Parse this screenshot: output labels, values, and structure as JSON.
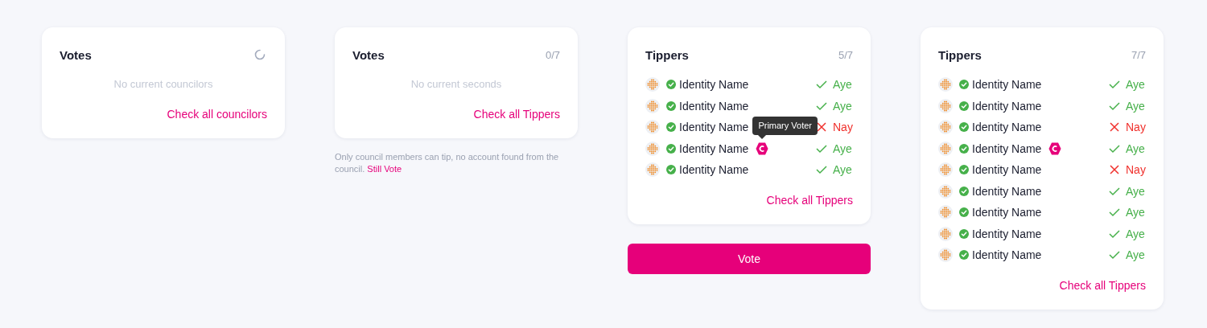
{
  "panels": [
    {
      "title": "Votes",
      "loading": true,
      "empty_text": "No current councilors",
      "link": "Check all councilors"
    },
    {
      "title": "Votes",
      "count": "0/7",
      "empty_text": "No current seconds",
      "link": "Check all Tippers",
      "note": {
        "text": "Only council members can tip, no account found from the council.",
        "link": "Still Vote"
      }
    },
    {
      "title": "Tippers",
      "count": "5/7",
      "voters": [
        {
          "name": "Identity Name",
          "kind": "aye",
          "vote": "Aye"
        },
        {
          "name": "Identity Name",
          "kind": "aye",
          "vote": "Aye"
        },
        {
          "name": "Identity Name",
          "kind": "nay",
          "vote": "Nay"
        },
        {
          "name": "Identity Name",
          "kind": "aye",
          "vote": "Aye",
          "primary": true,
          "tooltip": "Primary Voter"
        },
        {
          "name": "Identity Name",
          "kind": "aye",
          "vote": "Aye"
        }
      ],
      "link": "Check all Tippers",
      "button": "Vote"
    },
    {
      "title": "Tippers",
      "count": "7/7",
      "voters": [
        {
          "name": "Identity Name",
          "kind": "aye",
          "vote": "Aye"
        },
        {
          "name": "Identity Name",
          "kind": "aye",
          "vote": "Aye"
        },
        {
          "name": "Identity Name",
          "kind": "nay",
          "vote": "Nay"
        },
        {
          "name": "Identity Name",
          "kind": "aye",
          "vote": "Aye",
          "primary": true
        },
        {
          "name": "Identity Name",
          "kind": "nay",
          "vote": "Nay"
        },
        {
          "name": "Identity Name",
          "kind": "aye",
          "vote": "Aye"
        },
        {
          "name": "Identity Name",
          "kind": "aye",
          "vote": "Aye"
        },
        {
          "name": "Identity Name",
          "kind": "aye",
          "vote": "Aye"
        },
        {
          "name": "Identity Name",
          "kind": "aye",
          "vote": "Aye"
        }
      ],
      "link": "Check all Tippers"
    }
  ]
}
